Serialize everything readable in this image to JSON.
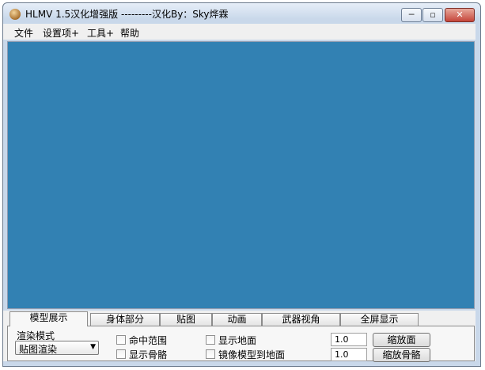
{
  "window": {
    "title": "HLMV 1.5汉化增强版 ---------汉化By：Sky烨霖",
    "min_glyph": "─",
    "max_glyph": "▫",
    "close_glyph": "✕"
  },
  "menu": {
    "items": [
      "文件",
      "设置项+",
      "工具+",
      "帮助"
    ]
  },
  "viewport": {
    "background": "#3281b3"
  },
  "tabs": [
    "模型展示",
    "身体部分",
    "贴图",
    "动画",
    "武器视角",
    "全屏显示"
  ],
  "panel": {
    "render_mode_label": "渲染模式",
    "render_mode_value": "贴图渲染",
    "dropdown_arrow": "▼",
    "checkboxes": [
      "命中范围",
      "显示骨骼",
      "显示地面",
      "镜像模型到地面"
    ],
    "scale_mesh_value": "1.0",
    "scale_bones_value": "1.0",
    "scale_mesh_button": "缩放面",
    "scale_bones_button": "缩放骨骼"
  }
}
